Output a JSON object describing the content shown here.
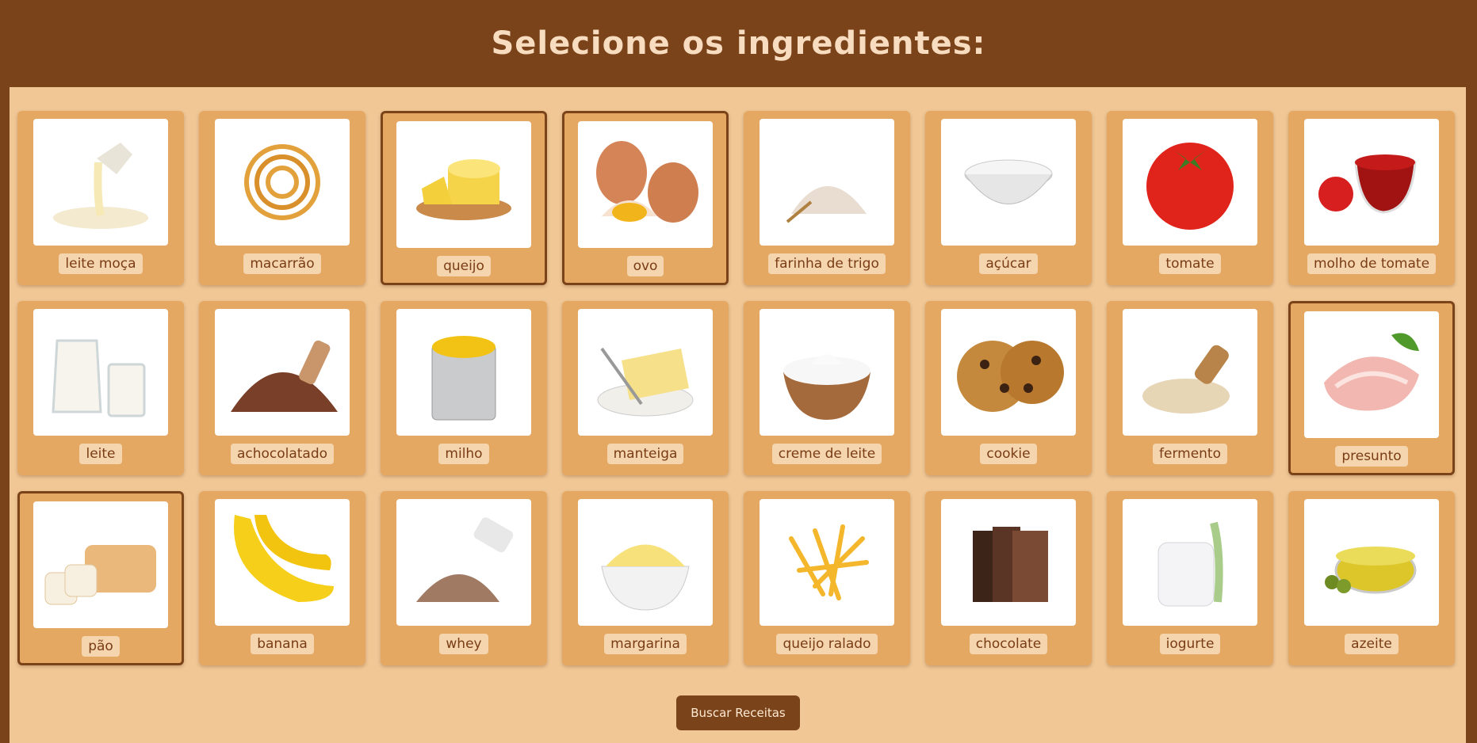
{
  "header": {
    "title": "Selecione os ingredientes:"
  },
  "ingredients": [
    {
      "label": "leite moça",
      "icon": "condensed-milk-icon",
      "selected": false
    },
    {
      "label": "macarrão",
      "icon": "pasta-icon",
      "selected": false
    },
    {
      "label": "queijo",
      "icon": "cheese-icon",
      "selected": true
    },
    {
      "label": "ovo",
      "icon": "egg-icon",
      "selected": true
    },
    {
      "label": "farinha de trigo",
      "icon": "flour-icon",
      "selected": false
    },
    {
      "label": "açúcar",
      "icon": "sugar-icon",
      "selected": false
    },
    {
      "label": "tomate",
      "icon": "tomato-icon",
      "selected": false
    },
    {
      "label": "molho de tomate",
      "icon": "tomato-sauce-icon",
      "selected": false
    },
    {
      "label": "leite",
      "icon": "milk-icon",
      "selected": false
    },
    {
      "label": "achocolatado",
      "icon": "chocolate-powder-icon",
      "selected": false
    },
    {
      "label": "milho",
      "icon": "corn-can-icon",
      "selected": false
    },
    {
      "label": "manteiga",
      "icon": "butter-icon",
      "selected": false
    },
    {
      "label": "creme de leite",
      "icon": "cream-icon",
      "selected": false
    },
    {
      "label": "cookie",
      "icon": "cookie-icon",
      "selected": false
    },
    {
      "label": "fermento",
      "icon": "yeast-icon",
      "selected": false
    },
    {
      "label": "presunto",
      "icon": "ham-icon",
      "selected": true
    },
    {
      "label": "pão",
      "icon": "bread-icon",
      "selected": true
    },
    {
      "label": "banana",
      "icon": "banana-icon",
      "selected": false
    },
    {
      "label": "whey",
      "icon": "whey-icon",
      "selected": false
    },
    {
      "label": "margarina",
      "icon": "margarine-icon",
      "selected": false
    },
    {
      "label": "queijo ralado",
      "icon": "grated-cheese-icon",
      "selected": false
    },
    {
      "label": "chocolate",
      "icon": "chocolate-bar-icon",
      "selected": false
    },
    {
      "label": "iogurte",
      "icon": "yogurt-icon",
      "selected": false
    },
    {
      "label": "azeite",
      "icon": "olive-oil-icon",
      "selected": false
    }
  ],
  "search_button": {
    "label": "Buscar Receitas"
  },
  "colors": {
    "header_bg": "#7b431a",
    "panel_bg": "#f1c795",
    "card_bg": "#e5a862",
    "label_bg": "#f4d5ae",
    "label_text": "#7a3c15",
    "selected_border": "#7b431a"
  }
}
